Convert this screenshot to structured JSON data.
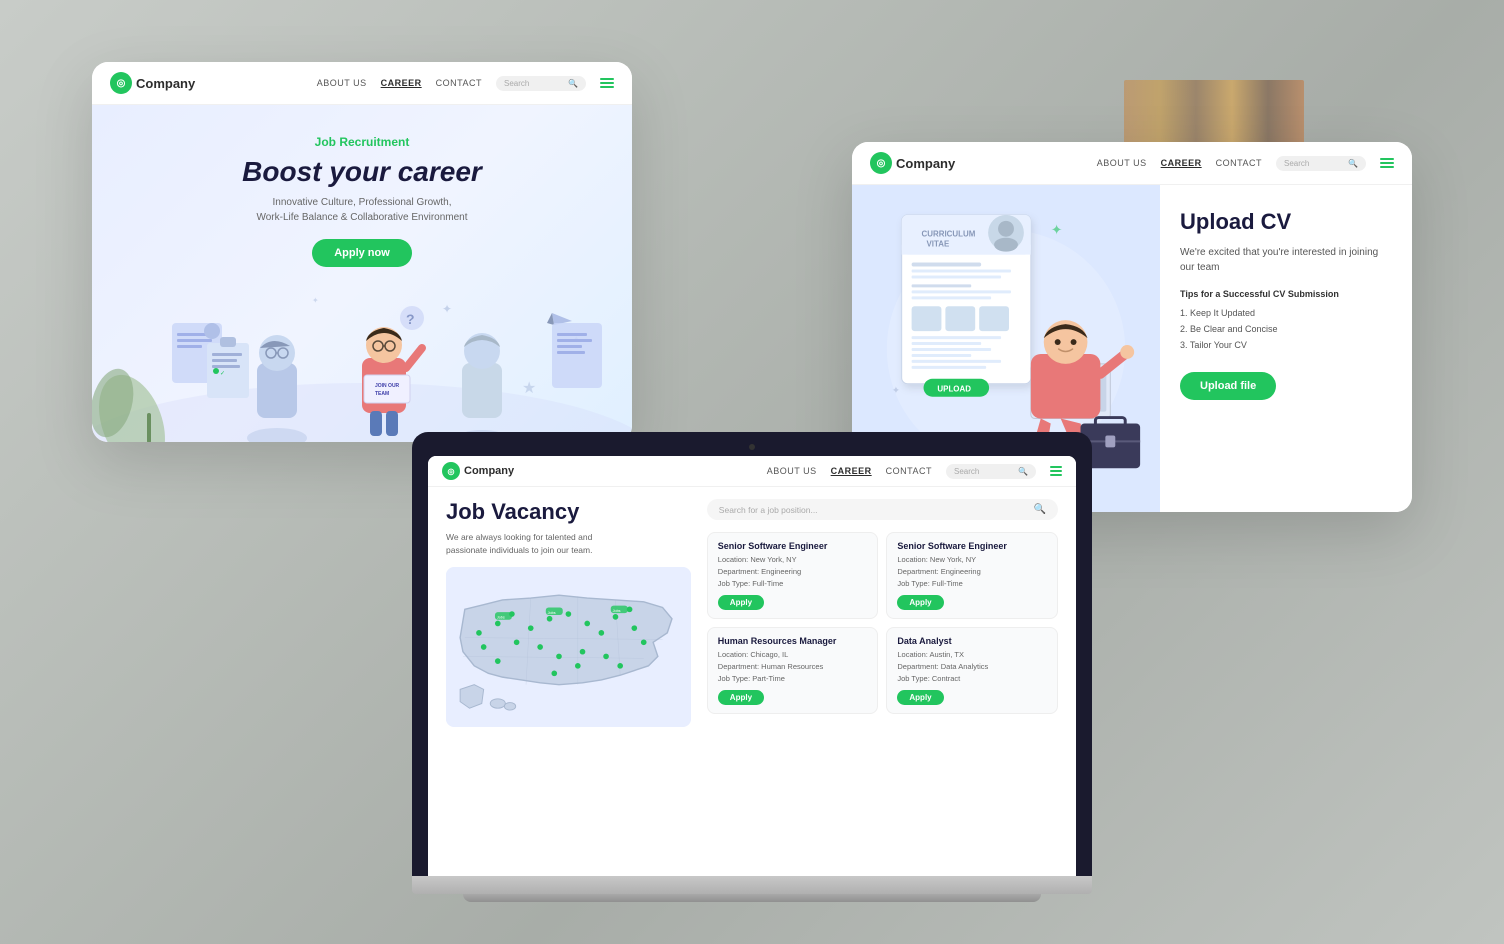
{
  "brand": {
    "name": "Company",
    "logo_symbol": "🔍"
  },
  "nav": {
    "about": "ABOUT US",
    "career": "CAREER",
    "contact": "CONTACT",
    "search_placeholder": "Search...",
    "career_active": true
  },
  "card1": {
    "label": "Job Recruitment",
    "title_normal": "Boost your",
    "title_bold": "career",
    "subtitle_line1": "Innovative Culture, Professional Growth,",
    "subtitle_line2": "Work-Life Balance & Collaborative Environment",
    "cta": "Apply now"
  },
  "card2": {
    "title": "Upload CV",
    "subtitle": "We're excited that you're interested in joining our team",
    "tips_title": "Tips for a Successful CV Submission",
    "tips": [
      "1. Keep It Updated",
      "2. Be Clear and Concise",
      "3. Tailor Your CV"
    ],
    "cta": "Upload file",
    "upload_badge": "UPLOAD"
  },
  "laptop": {
    "vacancy_title": "Job Vacancy",
    "vacancy_desc_line1": "We are always looking for talented and",
    "vacancy_desc_line2": "passionate individuals to join our team.",
    "search_placeholder": "Search for a job position...",
    "jobs": [
      {
        "title": "Senior Software Engineer",
        "location": "Location: New York, NY",
        "department": "Department: Engineering",
        "type": "Job Type: Full-Time",
        "cta": "Apply"
      },
      {
        "title": "Senior Software Engineer",
        "location": "Location: New York, NY",
        "department": "Department: Engineering",
        "type": "Job Type: Full-Time",
        "cta": "Apply"
      },
      {
        "title": "Human Resources Manager",
        "location": "Location: Chicago, IL",
        "department": "Department: Human Resources",
        "type": "Job Type: Part-Time",
        "cta": "Apply"
      },
      {
        "title": "Data Analyst",
        "location": "Location: Austin, TX",
        "department": "Department: Data Analytics",
        "type": "Job Type: Contract",
        "cta": "Apply"
      }
    ]
  },
  "colors": {
    "green": "#22c55e",
    "dark_navy": "#1a1a3e",
    "light_blue_bg": "#e8eeff"
  }
}
